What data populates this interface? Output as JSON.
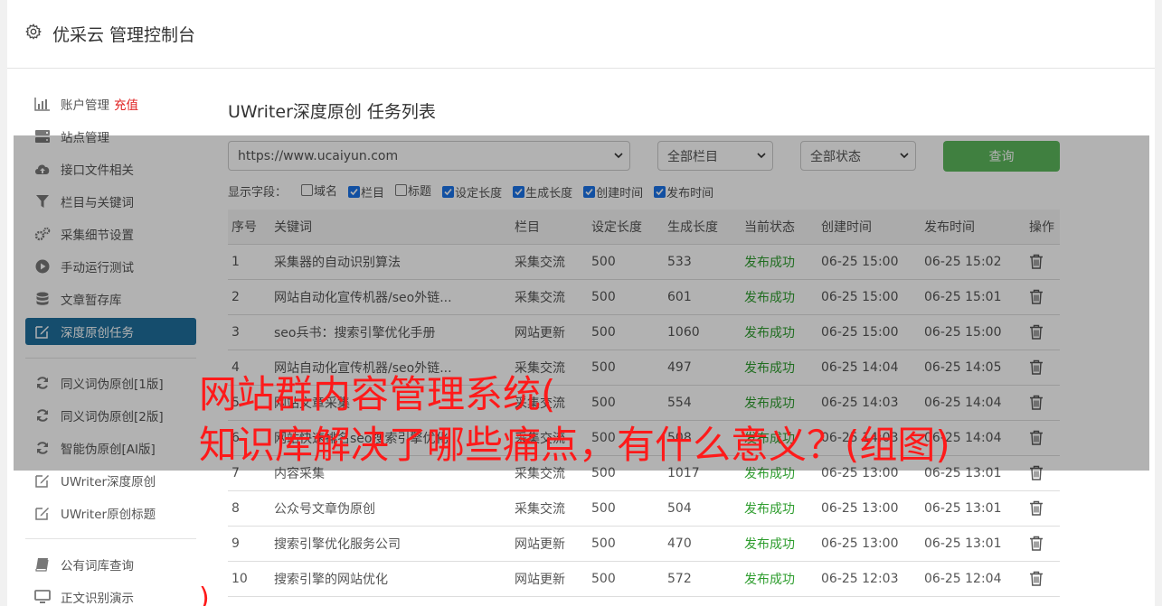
{
  "header": {
    "title": "优采云 管理控制台"
  },
  "sidebar": {
    "items": [
      {
        "label": "账户管理",
        "extra": "充值",
        "icon": "bar-chart-icon"
      },
      {
        "label": "站点管理",
        "icon": "server-icon"
      },
      {
        "label": "接口文件相关",
        "icon": "cloud-upload-icon"
      },
      {
        "label": "栏目与关键词",
        "icon": "filter-icon"
      },
      {
        "label": "采集细节设置",
        "icon": "cogs-icon"
      },
      {
        "label": "手动运行测试",
        "icon": "play-circle-icon"
      },
      {
        "label": "文章暂存库",
        "icon": "database-icon"
      },
      {
        "label": "深度原创任务",
        "icon": "edit-icon"
      },
      {
        "label": "同义词伪原创[1版]",
        "icon": "refresh-icon"
      },
      {
        "label": "同义词伪原创[2版]",
        "icon": "refresh-icon"
      },
      {
        "label": "智能伪原创[AI版]",
        "icon": "refresh-icon"
      },
      {
        "label": "UWriter深度原创",
        "icon": "edit-icon"
      },
      {
        "label": "UWriter原创标题",
        "icon": "edit-icon"
      },
      {
        "label": "公有词库查询",
        "icon": "book-icon"
      },
      {
        "label": "正文识别演示",
        "icon": "monitor-icon"
      }
    ]
  },
  "page": {
    "title": "UWriter深度原创 任务列表",
    "site_select": "https://www.ucaiyun.com",
    "column_select": "全部栏目",
    "status_select": "全部状态",
    "query_button": "查询",
    "fields_label": "显示字段：",
    "fields": [
      {
        "label": "域名",
        "checked": false
      },
      {
        "label": "栏目",
        "checked": true
      },
      {
        "label": "标题",
        "checked": false
      },
      {
        "label": "设定长度",
        "checked": true
      },
      {
        "label": "生成长度",
        "checked": true
      },
      {
        "label": "创建时间",
        "checked": true
      },
      {
        "label": "发布时间",
        "checked": true
      }
    ]
  },
  "table": {
    "headers": [
      "序号",
      "关键词",
      "栏目",
      "设定长度",
      "生成长度",
      "当前状态",
      "创建时间",
      "发布时间",
      "操作"
    ],
    "rows": [
      [
        "1",
        "采集器的自动识别算法",
        "采集交流",
        "500",
        "533",
        "发布成功",
        "06-25 15:00",
        "06-25 15:02"
      ],
      [
        "2",
        "网站自动化宣传机器/seo外链...",
        "采集交流",
        "500",
        "601",
        "发布成功",
        "06-25 15:00",
        "06-25 15:01"
      ],
      [
        "3",
        "seo兵书：搜索引擎优化手册",
        "网站更新",
        "500",
        "1060",
        "发布成功",
        "06-25 15:00",
        "06-25 15:00"
      ],
      [
        "4",
        "网站自动化宣传机器/seo外链...",
        "采集交流",
        "500",
        "497",
        "发布成功",
        "06-25 14:04",
        "06-25 14:05"
      ],
      [
        "5",
        "网站文章采集",
        "采集交流",
        "500",
        "554",
        "发布成功",
        "06-25 14:03",
        "06-25 14:04"
      ],
      [
        "6",
        "网站快速排名seo搜索引擎优化",
        "采集交流",
        "500",
        "508",
        "发布成功",
        "06-25 14:03",
        "06-25 14:04"
      ],
      [
        "7",
        "内容采集",
        "采集交流",
        "500",
        "1017",
        "发布成功",
        "06-25 13:00",
        "06-25 13:01"
      ],
      [
        "8",
        "公众号文章伪原创",
        "采集交流",
        "500",
        "504",
        "发布成功",
        "06-25 13:00",
        "06-25 13:01"
      ],
      [
        "9",
        "搜索引擎优化服务公司",
        "网站更新",
        "500",
        "470",
        "发布成功",
        "06-25 13:00",
        "06-25 13:01"
      ],
      [
        "10",
        "搜索引擎的网站优化",
        "网站更新",
        "500",
        "572",
        "发布成功",
        "06-25 12:03",
        "06-25 12:04"
      ]
    ]
  },
  "overlay": {
    "line1": "网站群内容管理系统(",
    "line2": "知识库解决了哪些痛点，有什么意义？(组图)",
    "line3": ")"
  },
  "colors": {
    "accent": "#1f6f9c",
    "query": "#5cb85c",
    "success": "#2e9d2e",
    "headline": "#ff1a1a"
  }
}
